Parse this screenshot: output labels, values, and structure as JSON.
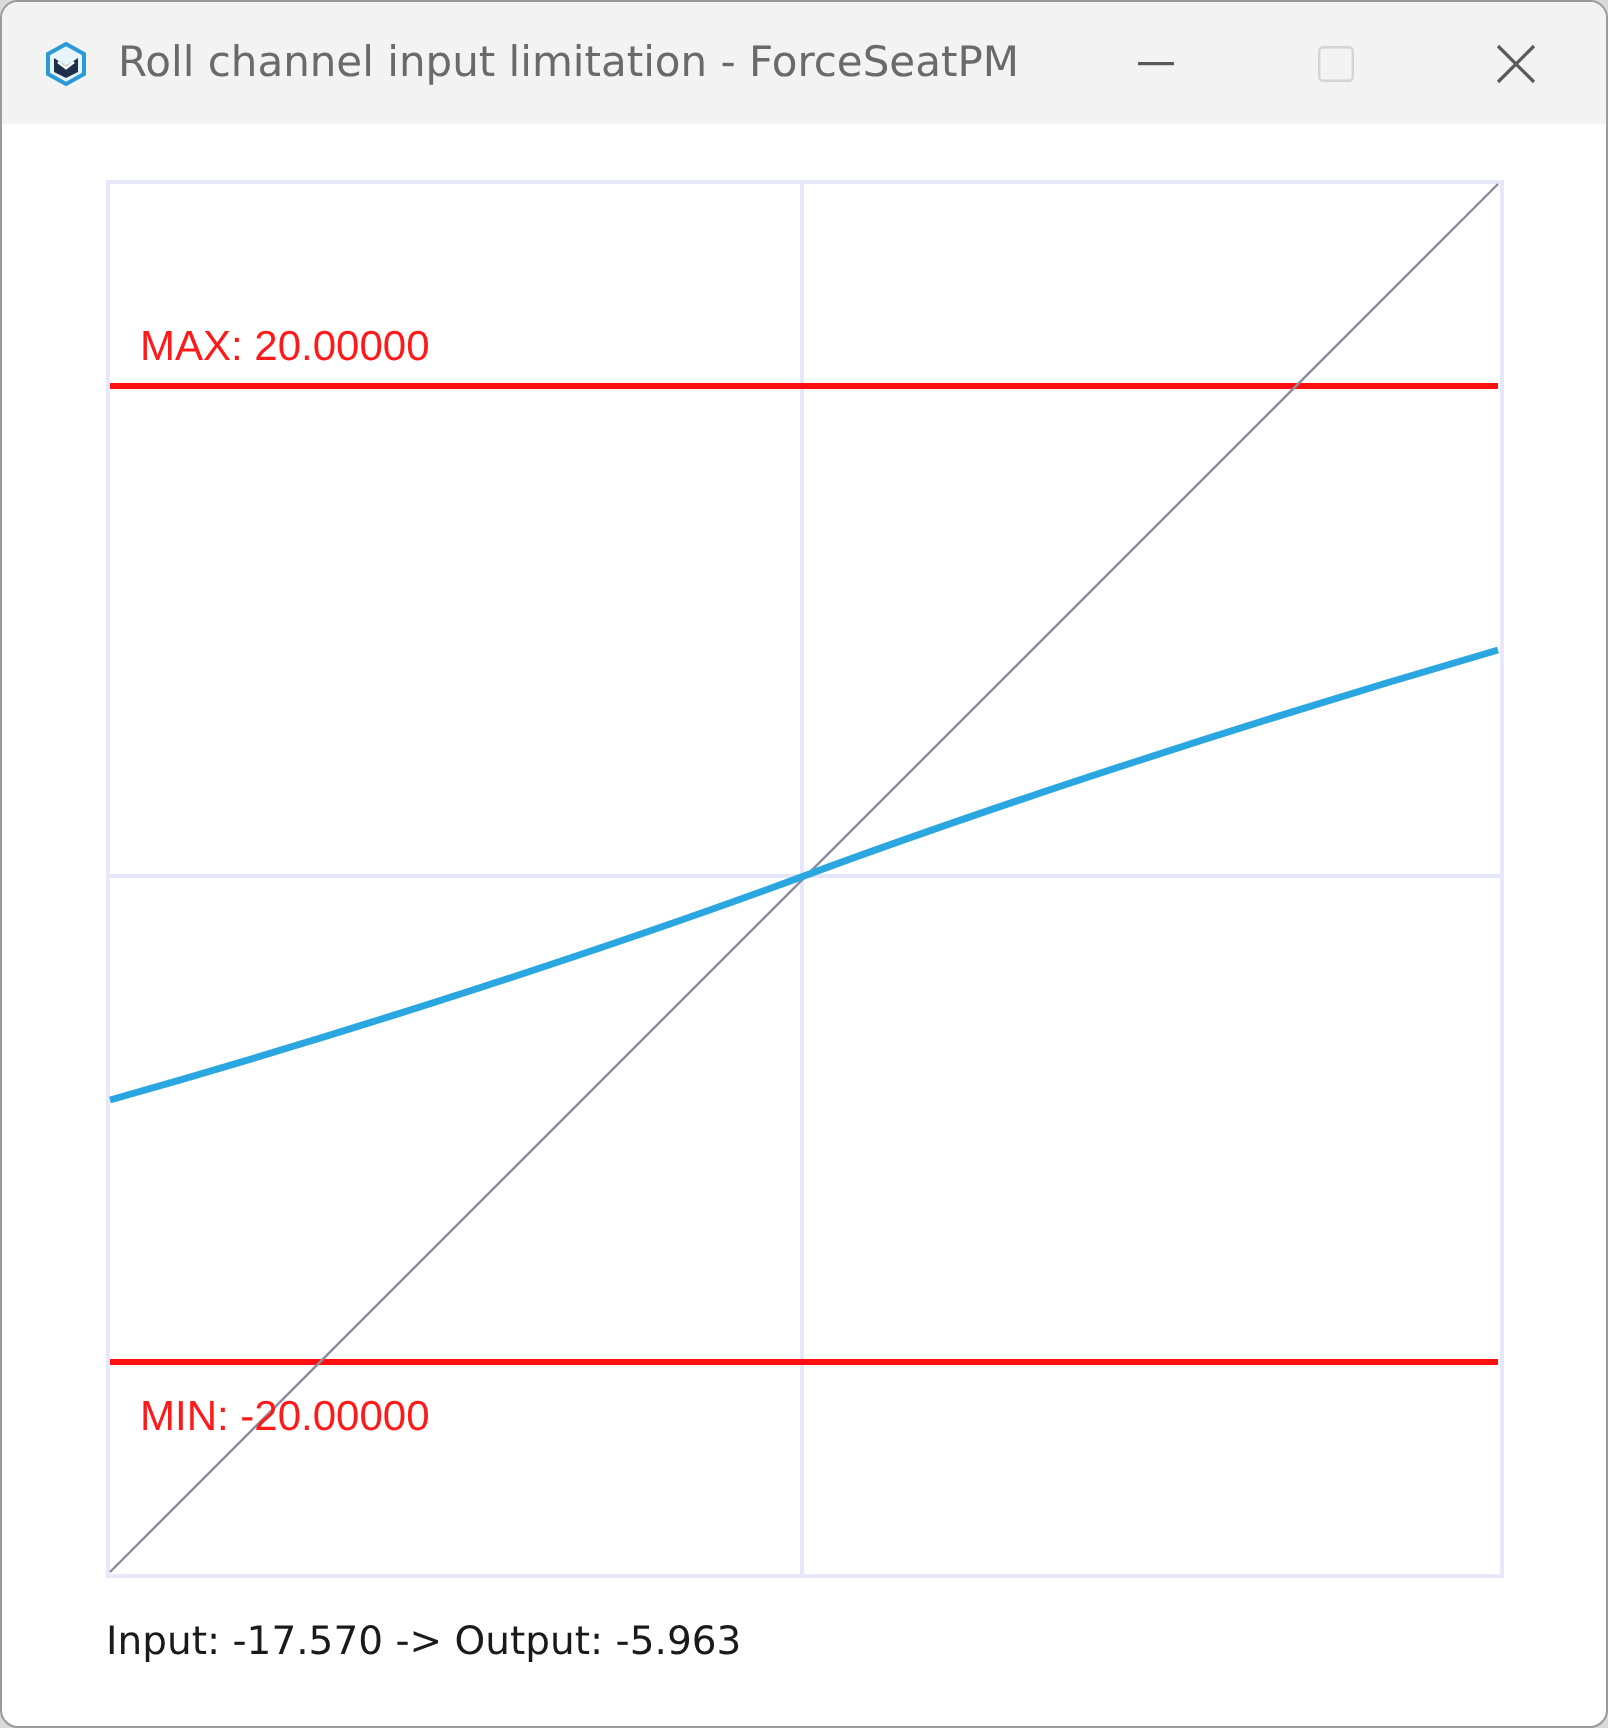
{
  "window": {
    "title": "Roll channel input limitation - ForceSeatPM",
    "controls": [
      {
        "kind": "minimize",
        "disabled": false
      },
      {
        "kind": "maximize",
        "disabled": true
      },
      {
        "kind": "close",
        "disabled": false
      }
    ]
  },
  "plot": {
    "max_label": "MAX: 20.00000",
    "min_label": "MIN: -20.00000"
  },
  "status": "Input: -17.570 -> Output: -5.963"
}
